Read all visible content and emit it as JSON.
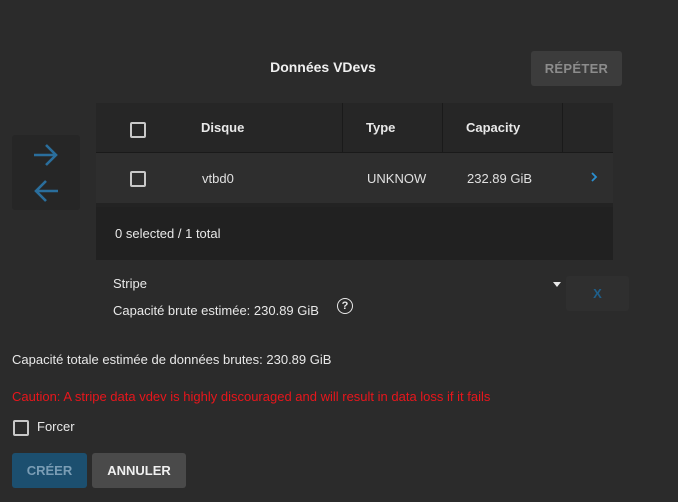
{
  "section": {
    "title": "Données VDevs",
    "repeat_label": "RÉPÉTER"
  },
  "table": {
    "headers": {
      "disk": "Disque",
      "type": "Type",
      "capacity": "Capacity"
    },
    "rows": [
      {
        "disk": "vtbd0",
        "type": "UNKNOW",
        "capacity": "232.89 GiB"
      }
    ],
    "footer": "0 selected / 1 total"
  },
  "vdev": {
    "layout_value": "Stripe",
    "estimated_raw": "Capacité brute estimée: 230.89 GiB",
    "help_glyph": "?",
    "remove_label": "X"
  },
  "summary": {
    "total": "Capacité totale estimée de données brutes: 230.89 GiB",
    "caution": "Caution: A stripe data vdev is highly discouraged and will result in data loss if it fails",
    "force_label": "Forcer"
  },
  "actions": {
    "create_label": "CRÉER",
    "cancel_label": "ANNULER"
  },
  "colors": {
    "accent": "#1f5f8a",
    "caution": "#e8161c",
    "arrow": "#2a6e9c"
  },
  "icons": {
    "move_right": "arrow-right-icon",
    "move_left": "arrow-left-icon",
    "row_chevron": "chevron-right-icon"
  }
}
